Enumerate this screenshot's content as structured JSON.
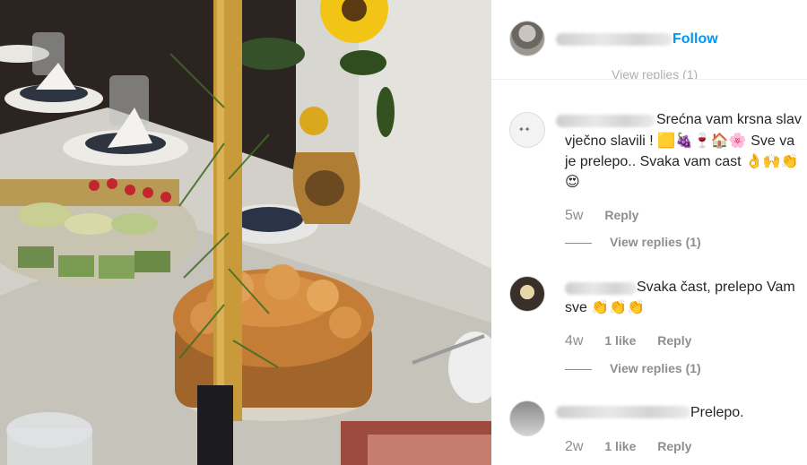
{
  "header": {
    "follow_label": "Follow",
    "ghost_replies": "View replies (1)"
  },
  "comments": [
    {
      "username": "goggyspans",
      "line1": "Srećna vam krsna slav",
      "line2": "vječno slavili ! 🟨🍇🍷🏠🌸 Sve va",
      "line3": "je prelepo.. Svaka vam cast 👌🙌👏",
      "line4": "😍",
      "time": "5w",
      "likes": "",
      "reply_label": "Reply",
      "view_replies": "View replies (1)"
    },
    {
      "username": "nadaieskic",
      "line1": "Svaka čast, prelepo Vam",
      "line2": "sve 👏👏👏",
      "time": "4w",
      "likes": "1 like",
      "reply_label": "Reply",
      "view_replies": "View replies (1)"
    },
    {
      "username": "",
      "line1": "Prelepo.",
      "time": "2w",
      "likes": "1 like",
      "reply_label": "Reply"
    }
  ],
  "colors": {
    "accent": "#0095f6",
    "muted": "#8e8e8e",
    "text": "#262626"
  },
  "icons": [
    "user-avatar",
    "blurred-username"
  ]
}
